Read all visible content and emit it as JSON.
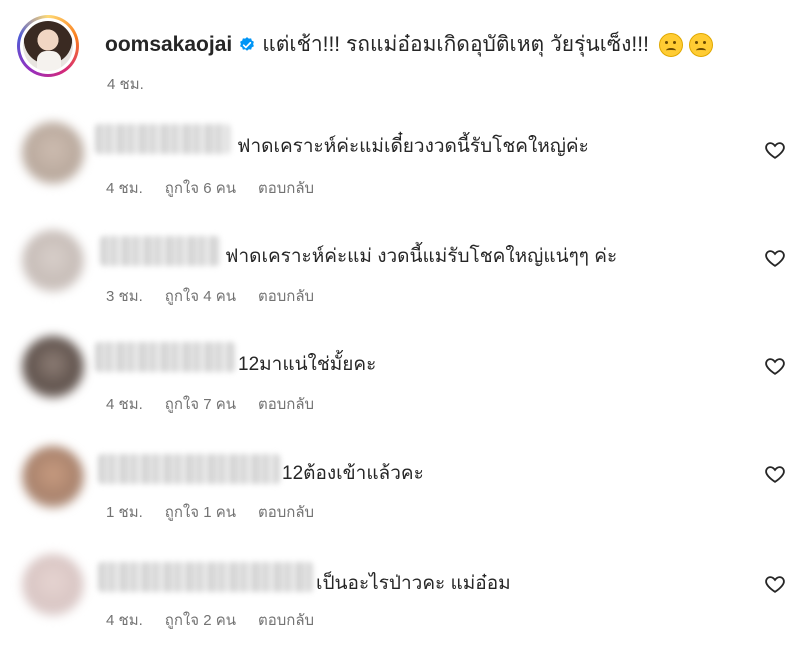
{
  "post": {
    "username": "oomsakaojai",
    "caption": "แต่เช้า!!! รถแม่อ๋อมเกิดอุบัติเหตุ วัยรุ่นเซ็ง!!!",
    "time": "4 ชม."
  },
  "comments": [
    {
      "text": "ฟาดเคราะห์ค่ะแม่เดี๋ยวงวดนี้รับโชคใหญ่ค่ะ",
      "time": "4 ชม.",
      "likes": "ถูกใจ 6 คน",
      "reply": "ตอบกลับ"
    },
    {
      "text": "ฟาดเคราะห์ค่ะแม่ งวดนี้แม่รับโชคใหญ่แน่ๆๆ ค่ะ",
      "time": "3 ชม.",
      "likes": "ถูกใจ 4 คน",
      "reply": "ตอบกลับ"
    },
    {
      "text": "12มาแน่ใช่มั้ยคะ",
      "time": "4 ชม.",
      "likes": "ถูกใจ 7 คน",
      "reply": "ตอบกลับ"
    },
    {
      "text": "12ต้องเข้าแล้วคะ",
      "time": "1 ชม.",
      "likes": "ถูกใจ 1 คน",
      "reply": "ตอบกลับ"
    },
    {
      "text": "เป็นอะไรป่าวคะ แม่อ๋อม",
      "time": "4 ชม.",
      "likes": "ถูกใจ 2 คน",
      "reply": "ตอบกลับ"
    }
  ],
  "icons": {
    "verified": "verified-badge-icon",
    "like": "heart-outline-icon",
    "emoji1": "face-with-rolling-eyes-emoji",
    "emoji2": "pensive-face-emoji"
  },
  "colors": {
    "verified": "#0095f6",
    "muted": "#737373",
    "text": "#262626"
  }
}
